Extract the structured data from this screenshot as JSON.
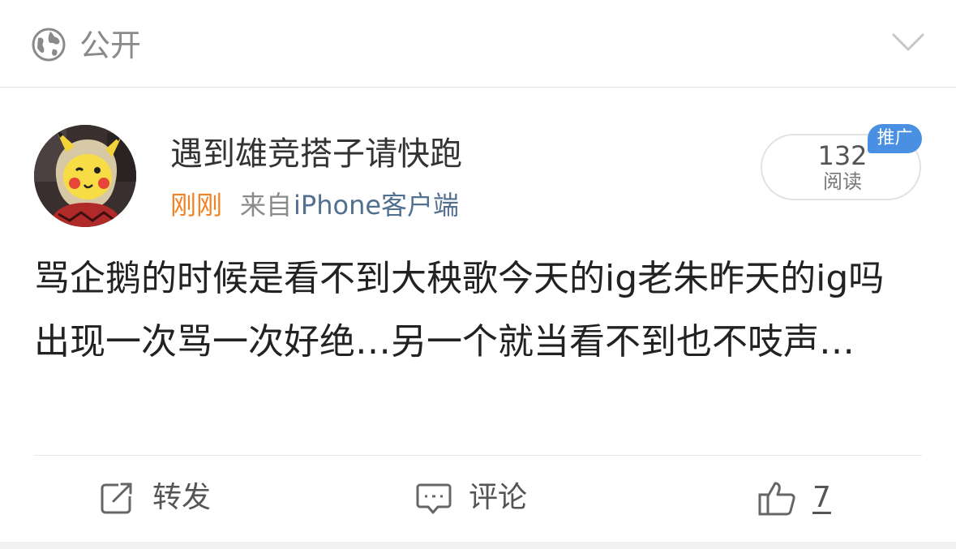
{
  "visibility": {
    "icon": "globe-icon",
    "label": "公开",
    "expand_icon": "chevron-down-icon"
  },
  "author": {
    "name": "遇到雄竞搭子请快跑",
    "avatar_icon": "avatar-pikachu"
  },
  "meta": {
    "time": "刚刚",
    "from_prefix": "来自",
    "client": "iPhone客户端"
  },
  "stats": {
    "read_count": "132",
    "read_label": "阅读",
    "promo_badge": "推广"
  },
  "post": {
    "text": "骂企鹅的时候是看不到大秧歌今天的ig老朱昨天的ig吗  出现一次骂一次好绝…另一个就当看不到也不吱声…"
  },
  "actions": {
    "repost_label": "转发",
    "comment_label": "评论",
    "like_count": "7"
  },
  "colors": {
    "time_accent": "#f58220",
    "client_link": "#52708f",
    "promo_badge": "#4a90e2",
    "muted_text": "#8a8a8a"
  }
}
